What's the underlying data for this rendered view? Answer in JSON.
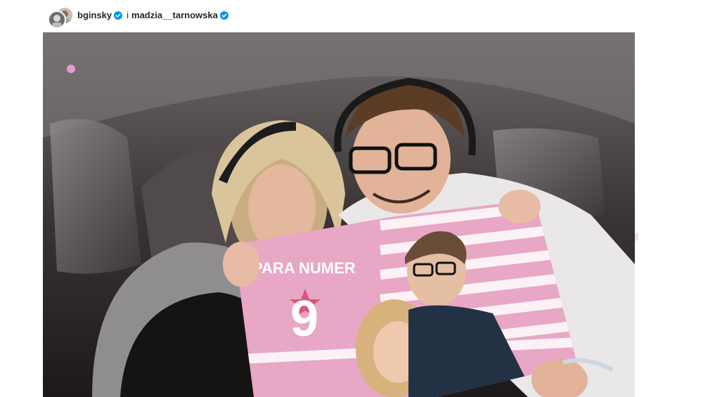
{
  "post": {
    "author_1": "bginsky",
    "separator": "i",
    "author_2": "madzia__tarnowska"
  },
  "banner": {
    "line1": "PARA NUMER",
    "number": "9"
  },
  "colors": {
    "verified": "#0095f6",
    "banner_pink": "#e8a7c4",
    "banner_stripe": "#d77aa6"
  }
}
